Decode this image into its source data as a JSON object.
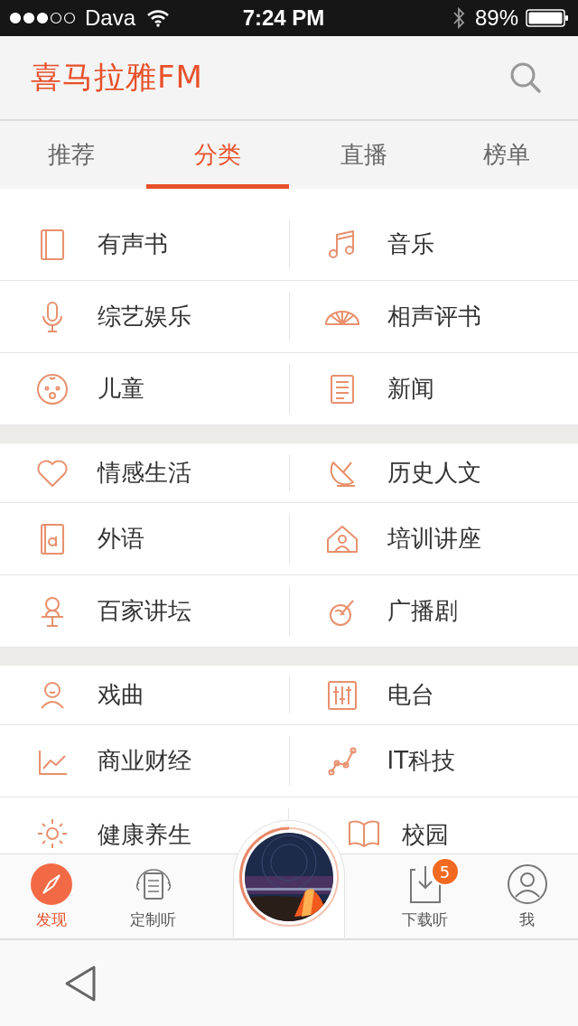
{
  "status_bar": {
    "carrier": "Dava",
    "time": "7:24 PM",
    "battery": "89%"
  },
  "header": {
    "logo": "喜马拉雅FM"
  },
  "tabs": [
    {
      "label": "推荐",
      "selected": false
    },
    {
      "label": "分类",
      "selected": true
    },
    {
      "label": "直播",
      "selected": false
    },
    {
      "label": "榜单",
      "selected": false
    }
  ],
  "sections": [
    {
      "items": [
        "有声书",
        "音乐",
        "综艺娱乐",
        "相声评书",
        "儿童",
        "新闻"
      ]
    },
    {
      "items": [
        "情感生活",
        "历史人文",
        "外语",
        "培训讲座",
        "百家讲坛",
        "广播剧"
      ]
    },
    {
      "items": [
        "戏曲",
        "电台",
        "商业财经",
        "IT科技",
        "健康养生",
        "校园"
      ]
    }
  ],
  "nav": [
    {
      "label": "发现",
      "selected": true
    },
    {
      "label": "定制听",
      "selected": false
    },
    {
      "label": "下载听",
      "selected": false,
      "badge": "5"
    },
    {
      "label": "我",
      "selected": false
    }
  ]
}
